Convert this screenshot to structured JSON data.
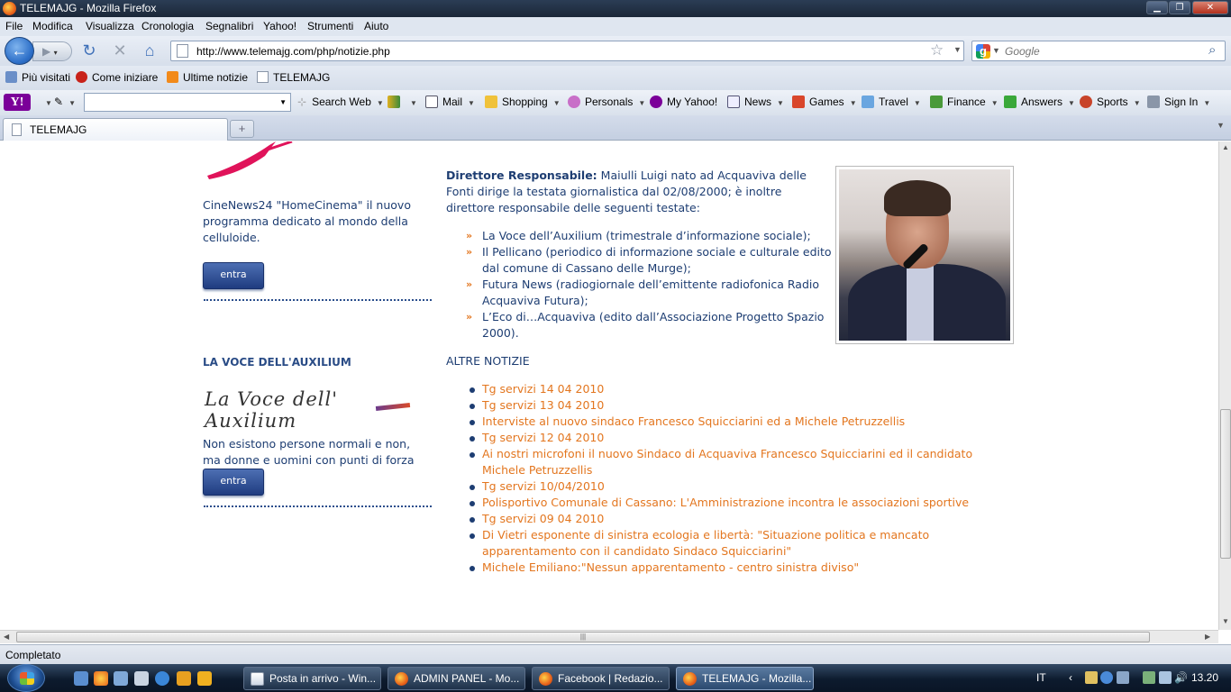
{
  "window": {
    "title": "TELEMAJG - Mozilla Firefox"
  },
  "menu": [
    "File",
    "Modifica",
    "Visualizza",
    "Cronologia",
    "Segnalibri",
    "Yahoo!",
    "Strumenti",
    "Aiuto"
  ],
  "nav": {
    "url": "http://www.telemajg.com/php/notizie.php",
    "search_placeholder": "Google"
  },
  "bookmarks": [
    "Più visitati",
    "Come iniziare",
    "Ultime notizie",
    "TELEMAJG"
  ],
  "yahoo_bar": [
    "Search Web",
    "Mail",
    "Shopping",
    "Personals",
    "My Yahoo!",
    "News",
    "Games",
    "Travel",
    "Finance",
    "Answers",
    "Sports",
    "Sign In"
  ],
  "tab": {
    "label": "TELEMAJG",
    "new_tab": "+"
  },
  "sidebar": {
    "cinenews_text": "CineNews24 \"HomeCinema\" il nuovo programma dedicato al mondo della celluloide.",
    "entra1": "entra",
    "voce_heading": "LA VOCE DELL'AUXILIUM",
    "voce_logo": "La Voce dell' Auxilium",
    "voce_text": "Non esistono persone normali e non, ma donne e uomini con punti di forza e ....",
    "entra2": "entra"
  },
  "main": {
    "direttore_label": "Direttore Responsabile:",
    "direttore_text": " Maiulli Luigi nato ad Acquaviva delle Fonti dirige la testata giornalistica dal 02/08/2000; è inoltre direttore responsabile delle seguenti testate:",
    "testate": [
      "La Voce dell’Auxilium (trimestrale d’informazione sociale);",
      "Il Pellicano (periodico di informazione sociale e culturale edito dal comune di Cassano delle Murge);",
      "Futura News (radiogiornale dell’emittente radiofonica Radio Acquaviva Futura);",
      "L’Eco di…Acquaviva (edito dall’Associazione Progetto Spazio 2000)."
    ],
    "altre_heading": "ALTRE NOTIZIE",
    "notizie": [
      "Tg servizi 14 04 2010",
      "Tg servizi 13 04 2010",
      "Interviste al nuovo sindaco Francesco Squicciarini ed a Michele Petruzzellis",
      "Tg servizi 12 04 2010",
      "Ai nostri microfoni il nuovo Sindaco di Acquaviva Francesco Squicciarini ed il candidato Michele Petruzzellis",
      "Tg servizi 10/04/2010",
      "Polisportivo Comunale di Cassano: L'Amministrazione incontra le associazioni sportive",
      "Tg servizi 09 04 2010",
      "Di Vietri esponente di sinistra ecologia e libertà: \"Situazione politica e mancato apparentamento con il candidato Sindaco Squicciarini\"",
      "Michele Emiliano:\"Nessun apparentamento - centro sinistra diviso\""
    ]
  },
  "status": {
    "text": "Completato"
  },
  "taskbar": {
    "buttons": [
      "Posta in arrivo - Win...",
      "ADMIN PANEL - Mo...",
      "Facebook | Redazio...",
      "TELEMAJG - Mozilla..."
    ],
    "lang": "IT",
    "clock": "13.20"
  }
}
